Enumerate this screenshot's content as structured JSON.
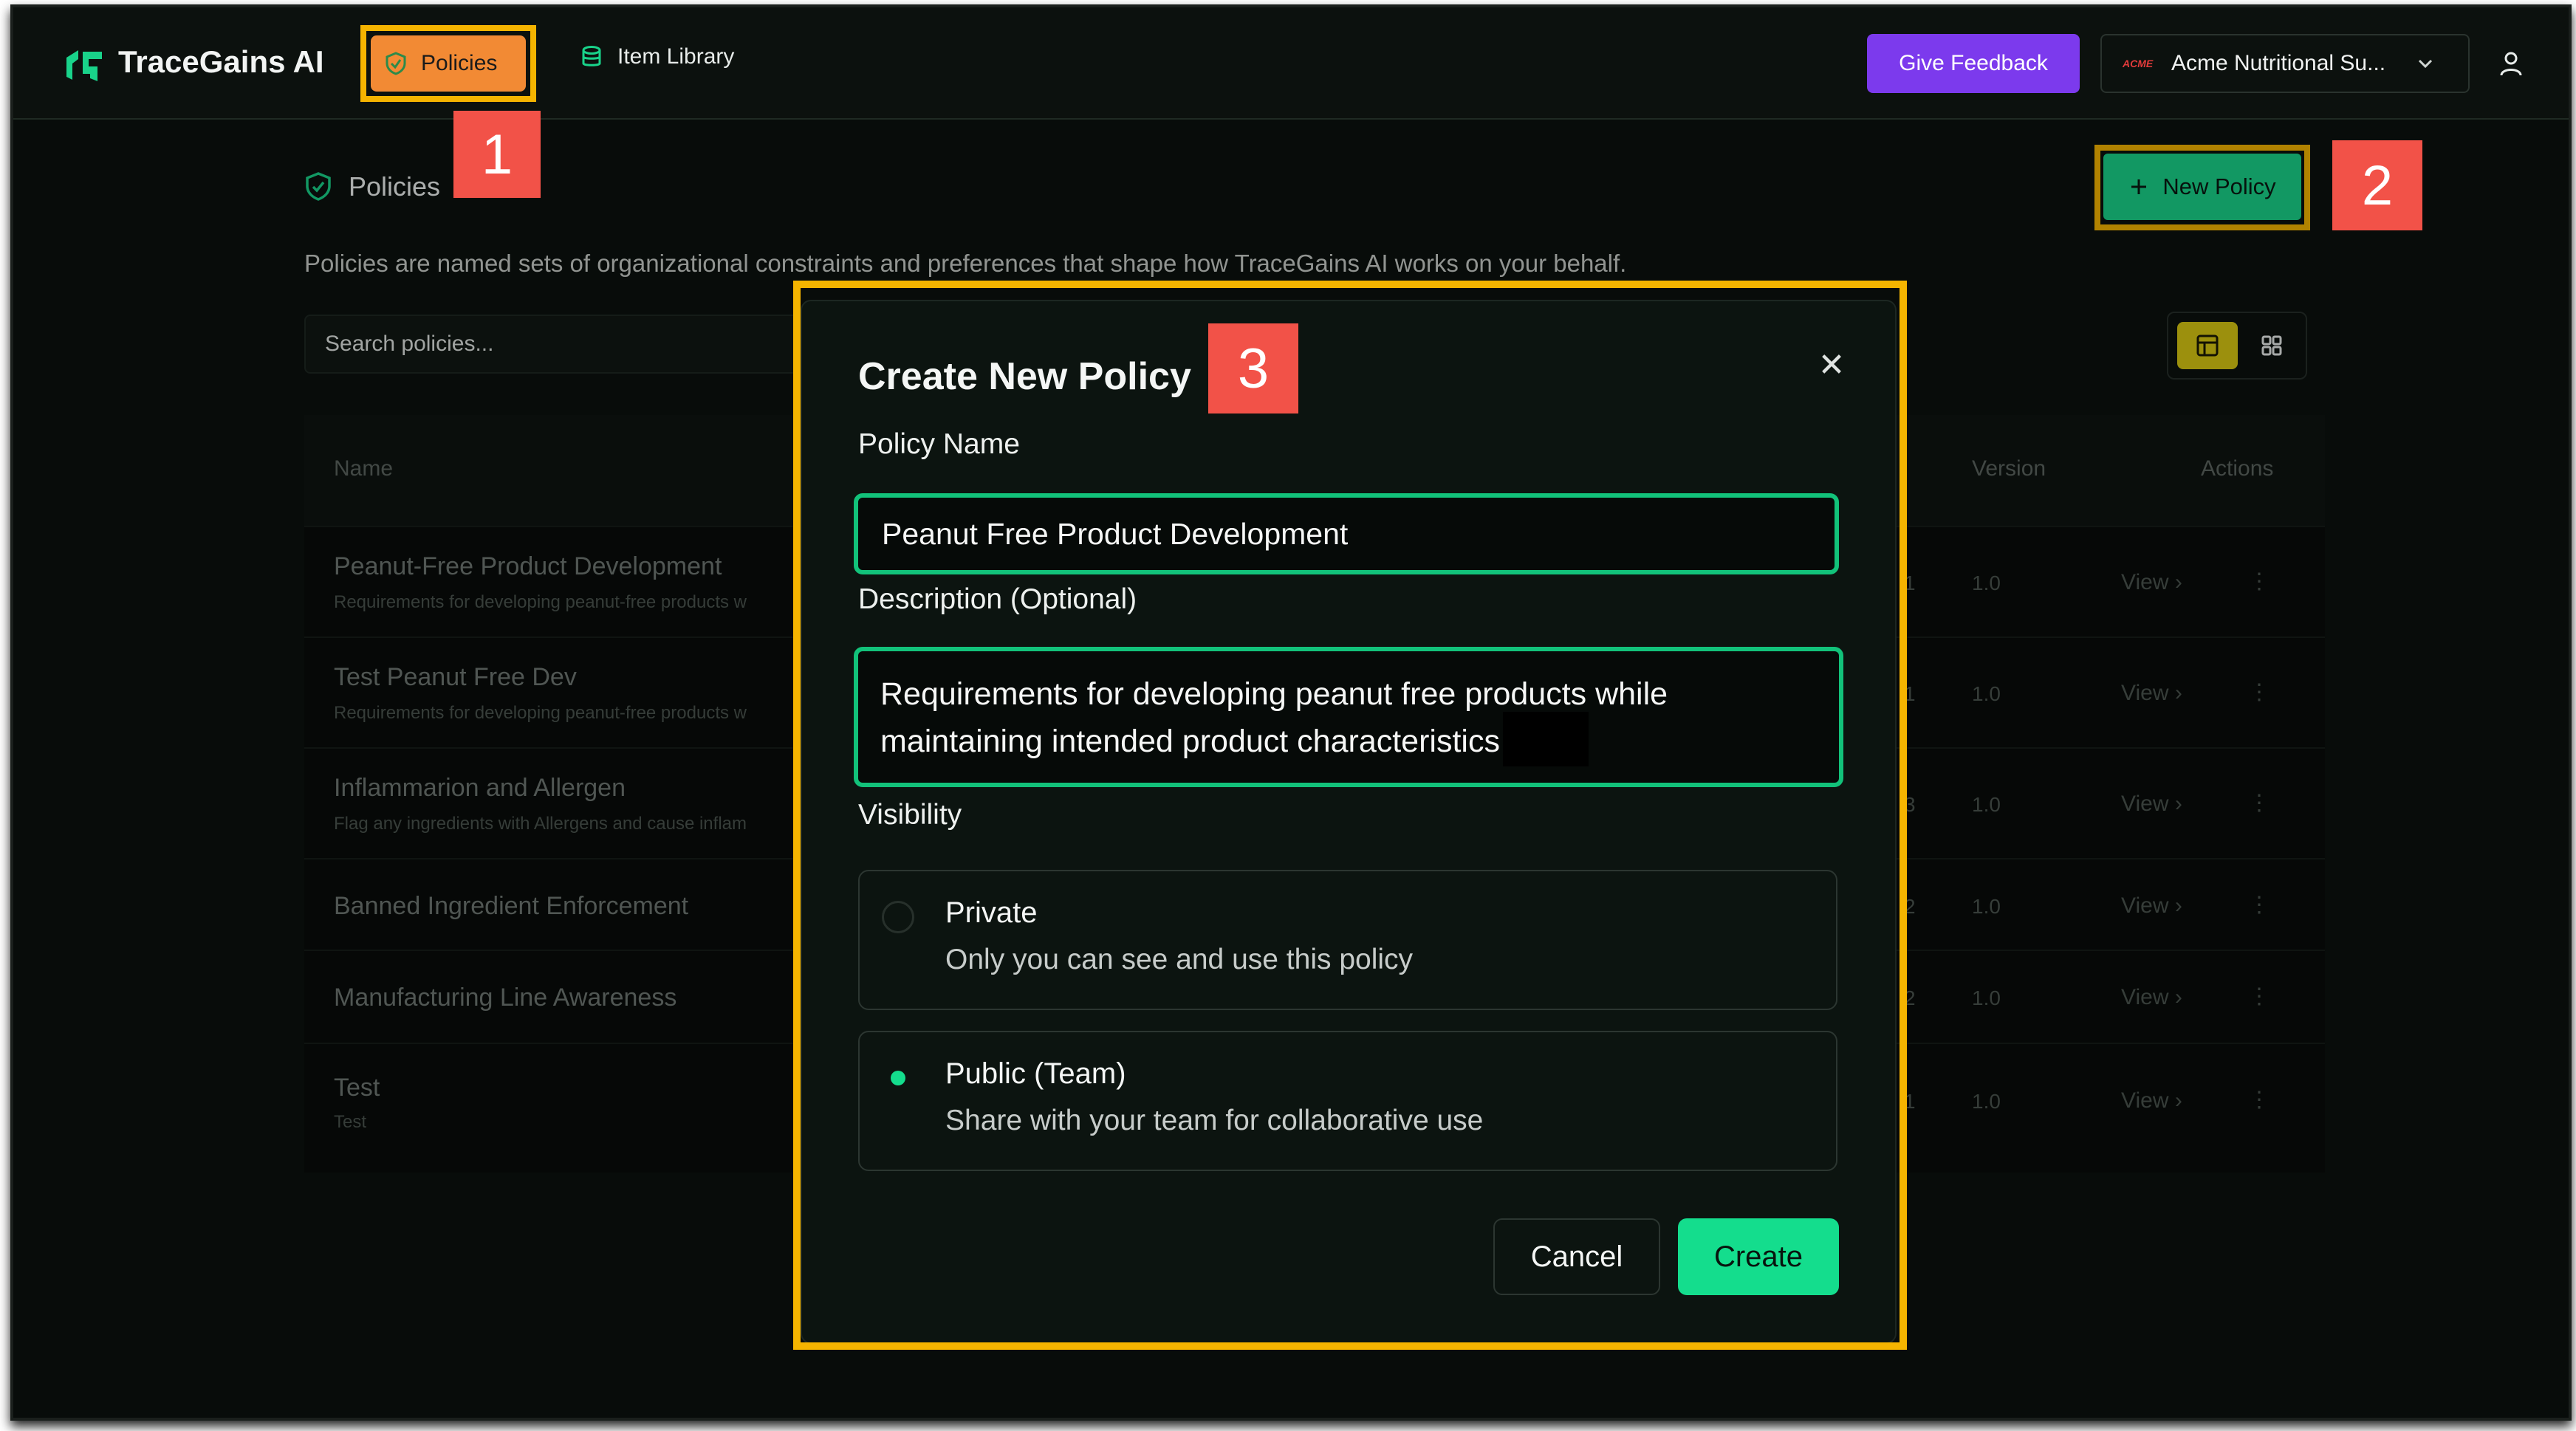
{
  "navbar": {
    "brand": "TraceGains AI",
    "policies_label": "Policies",
    "item_library_label": "Item Library",
    "feedback_label": "Give Feedback",
    "org_logo_text": "ACME",
    "org_name": "Acme Nutritional Su..."
  },
  "page": {
    "title": "Policies",
    "description": "Policies are named sets of organizational constraints and preferences that shape how TraceGains AI works on your behalf.",
    "new_policy_label": "New Policy",
    "search_placeholder": "Search policies..."
  },
  "table": {
    "headers": {
      "name": "Name",
      "version": "Version",
      "actions": "Actions"
    },
    "rows": [
      {
        "name": "Peanut-Free Product Development",
        "description": "Requirements for developing peanut-free products w",
        "status": "1",
        "version": "1.0",
        "view": "View"
      },
      {
        "name": "Test Peanut Free Dev",
        "description": "Requirements for developing peanut-free products w",
        "status": "1",
        "version": "1.0",
        "view": "View"
      },
      {
        "name": "Inflammarion and Allergen",
        "description": "Flag any ingredients with Allergens and cause inflam",
        "status": "3",
        "version": "1.0",
        "view": "View"
      },
      {
        "name": "Banned Ingredient Enforcement",
        "description": "",
        "status": "2",
        "version": "1.0",
        "view": "View"
      },
      {
        "name": "Manufacturing Line Awareness",
        "description": "",
        "status": "2",
        "version": "1.0",
        "view": "View"
      },
      {
        "name": "Test",
        "description": "Test",
        "status": "1",
        "version": "1.0",
        "view": "View"
      }
    ]
  },
  "modal": {
    "title": "Create New Policy",
    "policy_name_label": "Policy Name",
    "policy_name_value": "Peanut Free Product Development",
    "description_label": "Description (Optional)",
    "description_value": "Requirements for developing peanut free products while maintaining intended product characteristics",
    "visibility_label": "Visibility",
    "visibility_options": [
      {
        "title": "Private",
        "subtitle": "Only you can see and use this policy",
        "selected": false
      },
      {
        "title": "Public (Team)",
        "subtitle": "Share with your team for collaborative use",
        "selected": true
      }
    ],
    "cancel_label": "Cancel",
    "create_label": "Create"
  },
  "annotations": {
    "step1": "1",
    "step2": "2",
    "step3": "3",
    "highlight_color": "#f5b400",
    "badge_color": "#f25248"
  },
  "colors": {
    "accent": "#14dd8d",
    "feedback": "#7c3aed",
    "background": "#0c110e"
  }
}
